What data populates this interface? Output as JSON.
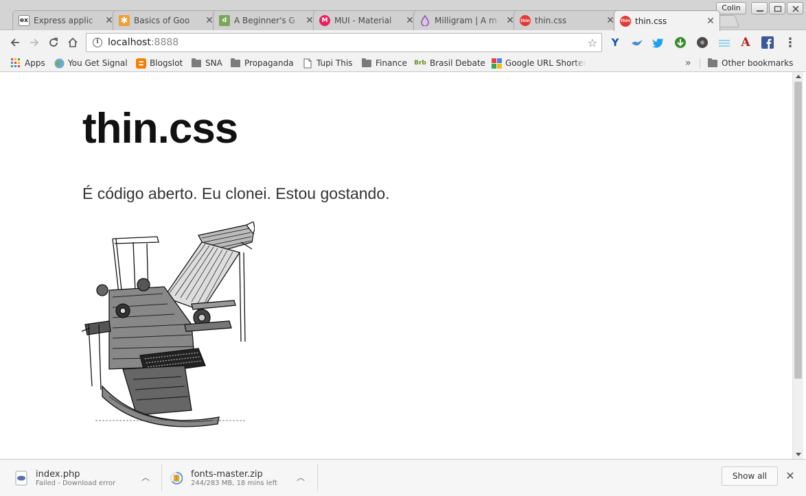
{
  "profile_name": "Colin",
  "tabs": [
    {
      "title": "Express applic",
      "favicon": "express-favicon",
      "active": false
    },
    {
      "title": "Basics of Goo",
      "favicon": "asterisk-favicon",
      "active": false
    },
    {
      "title": "A Beginner's G",
      "favicon": "d-favicon",
      "active": false
    },
    {
      "title": "MUI - Material",
      "favicon": "mui-favicon",
      "active": false
    },
    {
      "title": "Milligram | A m",
      "favicon": "milligram-drop-favicon",
      "active": false
    },
    {
      "title": "thin.css",
      "favicon": "thin-favicon",
      "active": false
    },
    {
      "title": "thin.css",
      "favicon": "thin-favicon",
      "active": true
    }
  ],
  "address": {
    "host": "localhost",
    "port": ":8888"
  },
  "bookmarks": [
    {
      "label": "Apps",
      "icon": "apps-grid-icon"
    },
    {
      "label": "You Get Signal",
      "icon": "globe-icon"
    },
    {
      "label": "Blogslot",
      "icon": "blogger-icon"
    },
    {
      "label": "SNA",
      "icon": "folder-icon"
    },
    {
      "label": "Propaganda",
      "icon": "folder-icon"
    },
    {
      "label": "Tupi This",
      "icon": "page-icon"
    },
    {
      "label": "Finance",
      "icon": "folder-icon"
    },
    {
      "label": "Brasil Debate",
      "icon": "brasil-debate-icon"
    },
    {
      "label": "Google URL Shorter",
      "icon": "google-shortener-icon"
    },
    {
      "label": "Other bookmarks",
      "icon": "folder-icon"
    }
  ],
  "bookmarks_overflow": "»",
  "page": {
    "title": "thin.css",
    "lead": "É código aberto. Eu clonei. Estou gostando.",
    "illustration": "printing-press-engraving"
  },
  "downloads": [
    {
      "name": "index.php",
      "status": "Failed - Download error"
    },
    {
      "name": "fonts-master.zip",
      "status": "244/283 MB, 18 mins left"
    }
  ],
  "show_all_label": "Show all",
  "colors": {
    "thin_red": "#e53935",
    "mui_pink": "#e91e63",
    "blogger_orange": "#f57d00",
    "twitter_blue": "#1da1f2",
    "facebook_blue": "#3b5998"
  }
}
